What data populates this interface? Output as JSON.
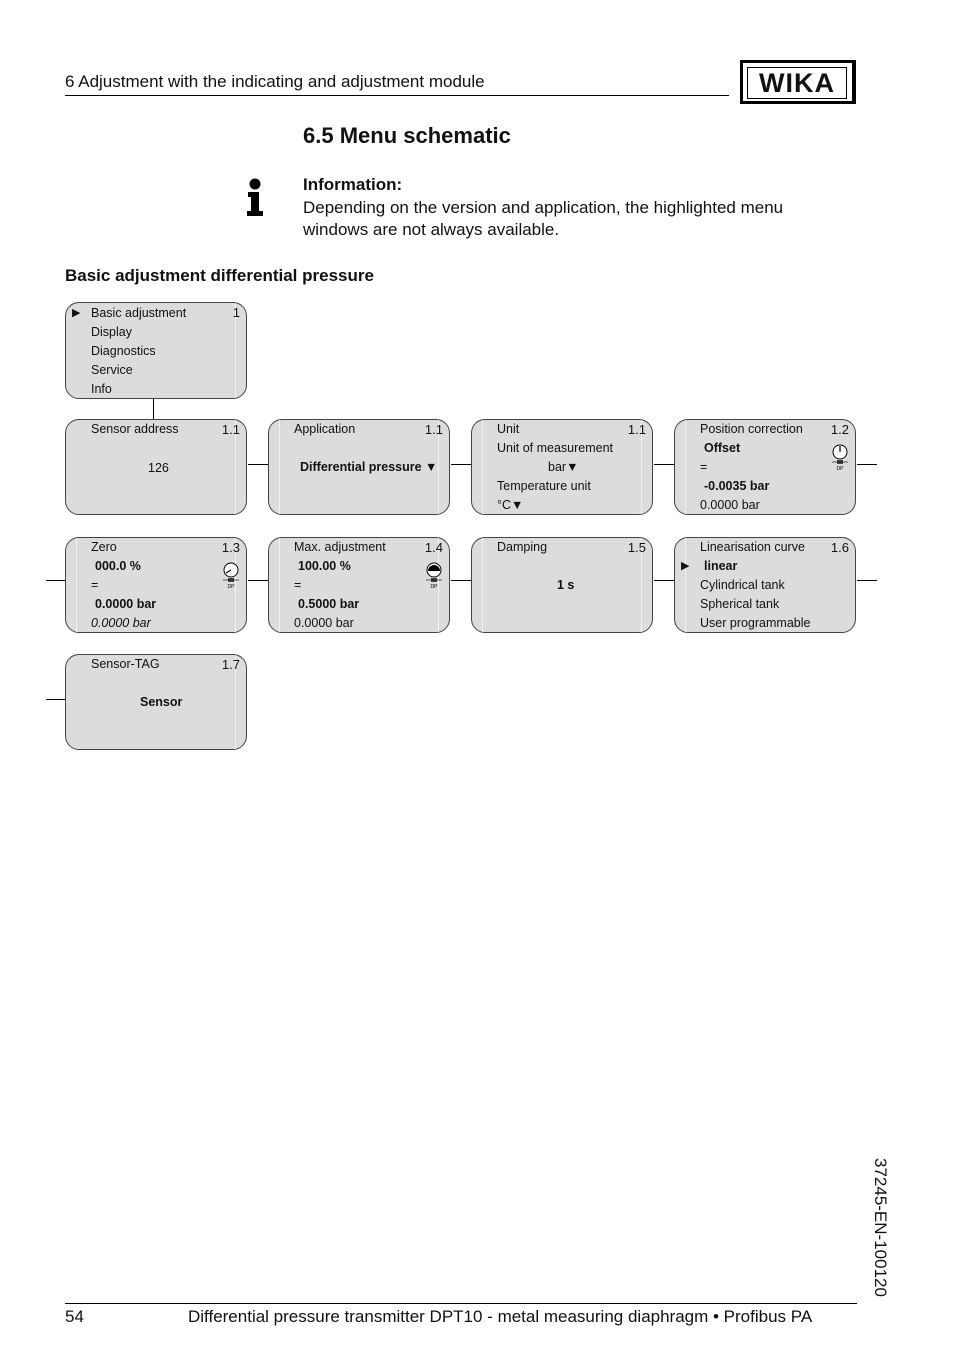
{
  "header": {
    "chapter": "6   Adjustment with the indicating and adjustment module",
    "logo": "WIKA"
  },
  "section": {
    "title": "6.5   Menu schematic"
  },
  "info": {
    "icon": "info-icon",
    "title": "Information:",
    "text": "Depending on the version and application, the highlighted menu windows are not always available."
  },
  "subheading": "Basic adjustment differential pressure",
  "main_menu": {
    "number": "1",
    "pointer": "▶",
    "items": [
      "Basic adjustment",
      "Display",
      "Diagnostics",
      "Service",
      "Info"
    ]
  },
  "boxes": {
    "sensor_address": {
      "title": "Sensor address",
      "number": "1.1",
      "value": "126"
    },
    "application": {
      "title": "Application",
      "number": "1.1",
      "value": "Differential pressure ▼"
    },
    "unit": {
      "title": "Unit",
      "number": "1.1",
      "line1": "Unit of measurement",
      "line2": "bar▼",
      "line3": "Temperature unit",
      "line4": "°C▼"
    },
    "position_correction": {
      "title": "Position correction",
      "number": "1.2",
      "line1": "Offset",
      "line2": "=",
      "line3": "-0.0035 bar",
      "line4": "0.0000 bar",
      "icon_label": "DP"
    },
    "zero": {
      "title": "Zero",
      "number": "1.3",
      "line1": "000.0 %",
      "line2": "=",
      "line3": "0.0000 bar",
      "line4": "0.0000 bar",
      "icon_label": "DP"
    },
    "max_adjustment": {
      "title": "Max. adjustment",
      "number": "1.4",
      "line1": "100.00 %",
      "line2": "=",
      "line3": "0.5000 bar",
      "line4": "0.0000 bar",
      "icon_label": "DP"
    },
    "damping": {
      "title": "Damping",
      "number": "1.5",
      "value": "1 s"
    },
    "linearisation": {
      "title": "Linearisation curve",
      "number": "1.6",
      "pointer": "▶",
      "items": [
        "linear",
        "Cylindrical tank",
        "Spherical tank",
        "User programmable"
      ]
    },
    "sensor_tag": {
      "title": "Sensor-TAG",
      "number": "1.7",
      "value": "Sensor"
    }
  },
  "footer": {
    "page": "54",
    "title": "Differential pressure transmitter DPT10 - metal measuring diaphragm • Profibus PA",
    "doc_id": "37245-EN-100120"
  }
}
